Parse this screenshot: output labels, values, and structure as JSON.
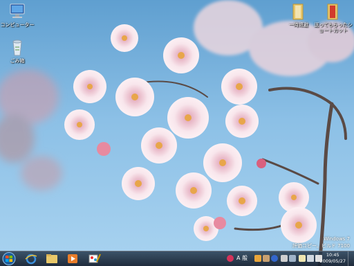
{
  "desktop_icons": [
    {
      "label": "コンピューター",
      "icon": "computer-icon"
    },
    {
      "label": "ごみ箱",
      "icon": "recycle-bin-icon"
    },
    {
      "label": "一時退避",
      "icon": "folder-icon"
    },
    {
      "label": "送ってもらったショートカット",
      "icon": "folder-icon"
    }
  ],
  "watermark": {
    "line1": "Windows 7",
    "line2": "評価コピー。ビルド 7100"
  },
  "taskbar": {
    "apps": [
      "windows-logo-icon",
      "internet-explorer-icon",
      "explorer-folder-icon",
      "media-player-icon",
      "paint-icon"
    ],
    "ime": "A 般",
    "clock_time": "10:45",
    "clock_date": "2009/05/27"
  },
  "colors": {
    "sky": "#8cc0e6",
    "blossom": "#f6dbe3",
    "taskbar": "#1e2d3e"
  }
}
